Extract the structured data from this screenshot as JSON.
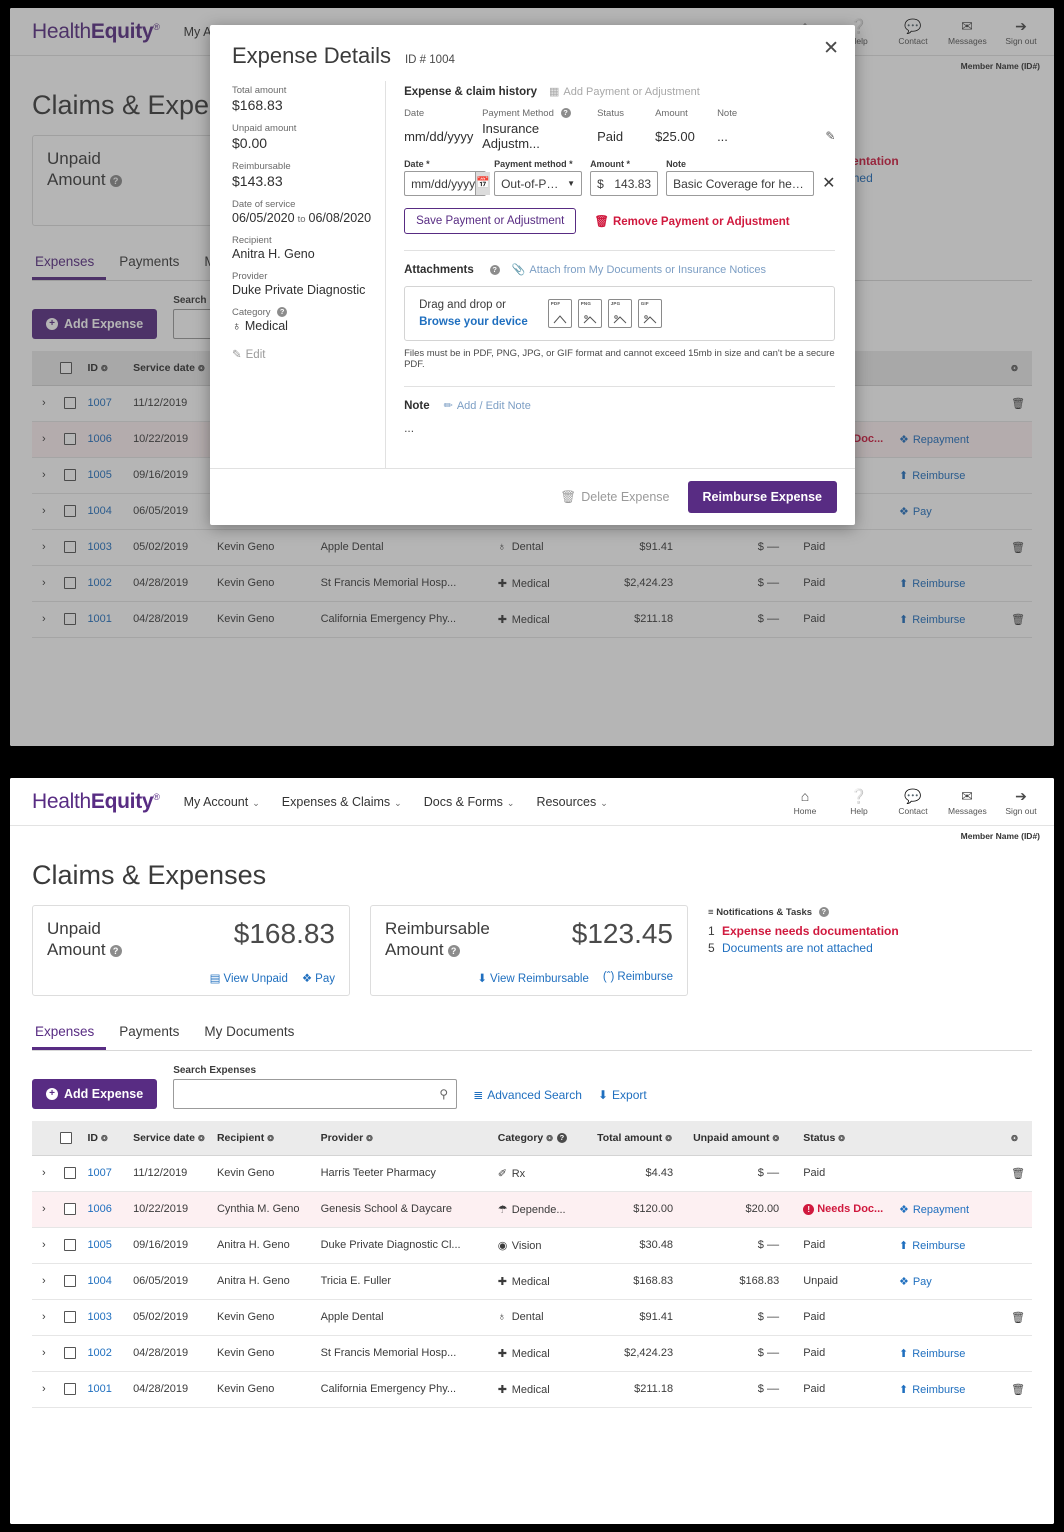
{
  "brand": {
    "name_light": "Health",
    "name_bold": "Equity",
    "tm": "®",
    "purple": "#582C83",
    "blue": "#1f6fbf",
    "red": "#D0193E"
  },
  "nav": {
    "items": [
      {
        "label": "My Account",
        "caret": "⌄"
      },
      {
        "label": "Expenses & Claims",
        "caret": "⌄"
      },
      {
        "label": "Docs & Forms",
        "caret": "⌄"
      },
      {
        "label": "Resources",
        "caret": "⌄"
      }
    ],
    "util": [
      {
        "icon": "⌂",
        "label": "Home",
        "name": "home-icon"
      },
      {
        "icon": "?",
        "label": "Help",
        "name": "help-icon"
      },
      {
        "icon": "●",
        "label": "Contact",
        "name": "contact-icon"
      },
      {
        "icon": "✉",
        "label": "Messages",
        "name": "messages-icon"
      },
      {
        "icon": "→",
        "label": "Sign out",
        "name": "signout-icon"
      }
    ],
    "member": "Member Name (ID#)"
  },
  "page": {
    "title": "Claims & Expenses"
  },
  "cards": [
    {
      "label_line1": "Unpaid",
      "label_line2": "Amount",
      "amount": "$168.83",
      "actions": [
        {
          "icon": "▤",
          "label": "View Unpaid"
        },
        {
          "icon": "❖",
          "label": "Pay"
        }
      ]
    },
    {
      "label_line1": "Reimbursable",
      "label_line2": "Amount",
      "amount": "$123.45",
      "actions": [
        {
          "icon": "⬇",
          "label": "View Reimbursable"
        },
        {
          "icon": "(˄)",
          "label": "Reimburse"
        }
      ]
    }
  ],
  "notifications": {
    "heading": "Notifications & Tasks",
    "lines": [
      {
        "count": "1",
        "text": "Expense needs documentation",
        "tone": "red"
      },
      {
        "count": "5",
        "text": "Documents are not attached",
        "tone": "blue"
      }
    ]
  },
  "tabs": [
    {
      "label": "Expenses",
      "active": true
    },
    {
      "label": "Payments",
      "active": false
    },
    {
      "label": "My Documents",
      "active": false
    }
  ],
  "toolbar": {
    "add_expense": "Add Expense",
    "search_label": "Search Expenses",
    "search_value": "",
    "search_placeholder": "",
    "advanced_search": "Advanced Search",
    "export": "Export"
  },
  "table": {
    "headers": [
      {
        "label": "ID",
        "sort": true
      },
      {
        "label": "Service date",
        "sort": true
      },
      {
        "label": "Recipient",
        "sort": true
      },
      {
        "label": "Provider",
        "sort": true
      },
      {
        "label": "Category",
        "sort": true,
        "help": true
      },
      {
        "label": "Total amount",
        "sort": true
      },
      {
        "label": "Unpaid amount",
        "sort": true
      },
      {
        "label": "Status",
        "sort": true
      },
      {
        "label": "",
        "sort": true
      }
    ],
    "rows": [
      {
        "id": "1007",
        "date": "11/12/2019",
        "recipient": "Kevin Geno",
        "provider": "Harris Teeter Pharmacy",
        "cat_icon": "✐",
        "category": "Rx",
        "total": "$4.43",
        "unpaid": "$  ––",
        "status": "Paid",
        "status_alert": false,
        "action": "",
        "action_icon": "",
        "trash": true,
        "alert": false
      },
      {
        "id": "1006",
        "date": "10/22/2019",
        "recipient": "Cynthia M. Geno",
        "provider": "Genesis School & Daycare",
        "cat_icon": "☂",
        "category": "Depende...",
        "total": "$120.00",
        "unpaid": "$20.00",
        "status": "Needs Doc...",
        "status_alert": true,
        "action": "Repayment",
        "action_icon": "❖",
        "trash": false,
        "alert": true
      },
      {
        "id": "1005",
        "date": "09/16/2019",
        "recipient": "Anitra H. Geno",
        "provider": "Duke Private Diagnostic Cl...",
        "cat_icon": "◉",
        "category": "Vision",
        "total": "$30.48",
        "unpaid": "$  ––",
        "status": "Paid",
        "status_alert": false,
        "action": "Reimburse",
        "action_icon": "⬆",
        "trash": false,
        "alert": false
      },
      {
        "id": "1004",
        "date": "06/05/2019",
        "recipient": "Anitra H. Geno",
        "provider": "Tricia E. Fuller",
        "cat_icon": "✚",
        "category": "Medical",
        "total": "$168.83",
        "unpaid": "$168.83",
        "status": "Unpaid",
        "status_alert": false,
        "action": "Pay",
        "action_icon": "❖",
        "trash": false,
        "alert": false
      },
      {
        "id": "1003",
        "date": "05/02/2019",
        "recipient": "Kevin Geno",
        "provider": "Apple Dental",
        "cat_icon": "♁",
        "category": "Dental",
        "total": "$91.41",
        "unpaid": "$  ––",
        "status": "Paid",
        "status_alert": false,
        "action": "",
        "action_icon": "",
        "trash": true,
        "alert": false
      },
      {
        "id": "1002",
        "date": "04/28/2019",
        "recipient": "Kevin Geno",
        "provider": "St Francis Memorial Hosp...",
        "cat_icon": "✚",
        "category": "Medical",
        "total": "$2,424.23",
        "unpaid": "$  ––",
        "status": "Paid",
        "status_alert": false,
        "action": "Reimburse",
        "action_icon": "⬆",
        "trash": false,
        "alert": false
      },
      {
        "id": "1001",
        "date": "04/28/2019",
        "recipient": "Kevin Geno",
        "provider": "California Emergency Phy...",
        "cat_icon": "✚",
        "category": "Medical",
        "total": "$211.18",
        "unpaid": "$  ––",
        "status": "Paid",
        "status_alert": false,
        "action": "Reimburse",
        "action_icon": "⬆",
        "trash": true,
        "alert": false
      }
    ]
  },
  "modal": {
    "title": "Expense Details",
    "id_label": "ID #",
    "id_value": "1004",
    "close": "✕",
    "left": {
      "total_label": "Total amount",
      "total_value": "$168.83",
      "unpaid_label": "Unpaid amount",
      "unpaid_value": "$0.00",
      "reimbursable_label": "Reimbursable",
      "reimbursable_value": "$143.83",
      "dos_label": "Date of service",
      "dos_from": "06/05/2020",
      "dos_to_word": "to",
      "dos_to": "06/08/2020",
      "recipient_label": "Recipient",
      "recipient_value": "Anitra H. Geno",
      "provider_label": "Provider",
      "provider_value": "Duke Private Diagnostic",
      "category_label": "Category",
      "category_icon": "♁",
      "category_value": "Medical",
      "edit_label": "Edit"
    },
    "history": {
      "title": "Expense & claim history",
      "add_action": "Add Payment or Adjustment",
      "headers": {
        "date": "Date",
        "method": "Payment Method",
        "status": "Status",
        "amount": "Amount",
        "note": "Note"
      },
      "row": {
        "date": "mm/dd/yyyy",
        "method": "Insurance Adjustm...",
        "status": "Paid",
        "amount": "$25.00",
        "note": "..."
      },
      "edit_form": {
        "date_label": "Date *",
        "date_value": "mm/dd/yyyy",
        "method_label": "Payment method *",
        "method_value": "Out-of-Pocke...",
        "amount_label": "Amount *",
        "amount_currency": "$",
        "amount_value": "143.83",
        "note_label": "Note",
        "note_value": "Basic Coverage for healt ...",
        "remove_x": "✕",
        "save_btn": "Save Payment or Adjustment",
        "remove_btn": "Remove Payment or Adjustment"
      }
    },
    "attachments": {
      "title": "Attachments",
      "attach_action": "Attach from My Documents or Insurance Notices",
      "drag_text": "Drag and drop or",
      "browse_text": "Browse your device",
      "filetypes": [
        "PDF",
        "PNG",
        "JPG",
        "GIF"
      ],
      "note": "Files must be in PDF, PNG, JPG, or GIF format and cannot exceed 15mb in size and can't be a secure PDF."
    },
    "note": {
      "title": "Note",
      "action": "Add / Edit Note",
      "body": "..."
    },
    "footer": {
      "delete": "Delete Expense",
      "reimburse": "Reimburse Expense"
    }
  }
}
